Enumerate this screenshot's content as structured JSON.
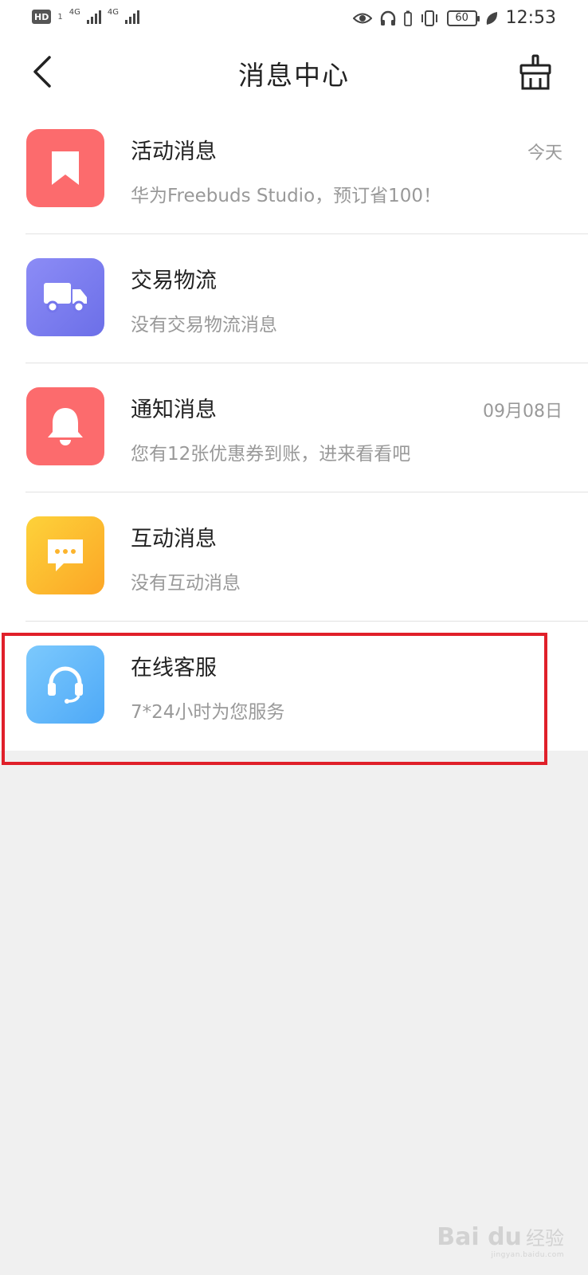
{
  "status_bar": {
    "hd_label": "HD",
    "sim_label": "1",
    "network_1": "4G",
    "network_2": "4G",
    "battery_level": "60",
    "time": "12:53"
  },
  "header": {
    "title": "消息中心"
  },
  "colors": {
    "activity": "#fc6b6d",
    "logistics": "#7b7cf0",
    "notice": "#fc6b6d",
    "interaction": "#fdb92d",
    "service": "#5eb9fb",
    "highlight": "#e0202a"
  },
  "messages": [
    {
      "title": "活动消息",
      "subtitle": "华为Freebuds Studio，预订省100！",
      "date": "今天",
      "icon": "bookmark-icon"
    },
    {
      "title": "交易物流",
      "subtitle": "没有交易物流消息",
      "date": "",
      "icon": "truck-icon"
    },
    {
      "title": "通知消息",
      "subtitle": "您有12张优惠券到账，进来看看吧",
      "date": "09月08日",
      "icon": "bell-icon"
    },
    {
      "title": "互动消息",
      "subtitle": "没有互动消息",
      "date": "",
      "icon": "chat-bubble-icon"
    },
    {
      "title": "在线客服",
      "subtitle": "7*24小时为您服务",
      "date": "",
      "icon": "headset-icon"
    }
  ],
  "watermark": {
    "logo": "Bai du",
    "cn": "经验",
    "url": "jingyan.baidu.com"
  }
}
